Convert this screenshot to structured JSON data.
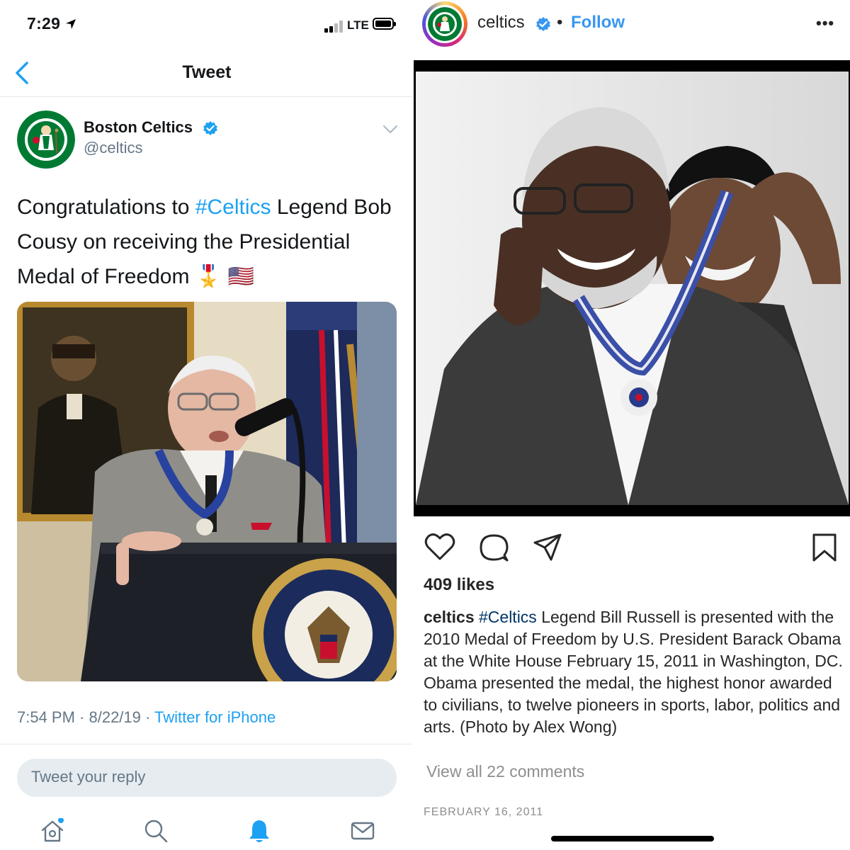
{
  "twitter": {
    "status_bar": {
      "time": "7:29",
      "network": "LTE"
    },
    "nav": {
      "title": "Tweet"
    },
    "tweet": {
      "author_name": "Boston Celtics",
      "author_handle": "@celtics",
      "text_before": "Congratulations to ",
      "hashtag": "#Celtics",
      "text_after": " Legend Bob Cousy on receiving the Presidential Medal of Freedom 🎖️ 🇺🇸",
      "timestamp": "7:54 PM · 8/22/19 · ",
      "source": "Twitter for iPhone"
    },
    "reply_placeholder": "Tweet your reply",
    "tab_bar": [
      "home-icon",
      "search-icon",
      "notifications-icon",
      "messages-icon"
    ],
    "colors": {
      "accent": "#1da1f2",
      "muted": "#657786"
    }
  },
  "instagram": {
    "username": "celtics",
    "separator": "•",
    "follow_label": "Follow",
    "more_label": "•••",
    "likes": "409 likes",
    "caption": {
      "user": "celtics",
      "hashtag": "#Celtics",
      "text": " Legend Bill Russell is presented with the 2010 Medal of Freedom by U.S. President Barack Obama at the White House February 15, 2011 in Washington, DC. Obama presented the medal, the highest honor awarded to civilians, to twelve pioneers in sports, labor, politics and arts. (Photo by Alex Wong)"
    },
    "view_all_comments": "View all 22 comments",
    "date": "FEBRUARY 16, 2011",
    "colors": {
      "follow": "#3897f0",
      "hashtag": "#003569"
    }
  }
}
